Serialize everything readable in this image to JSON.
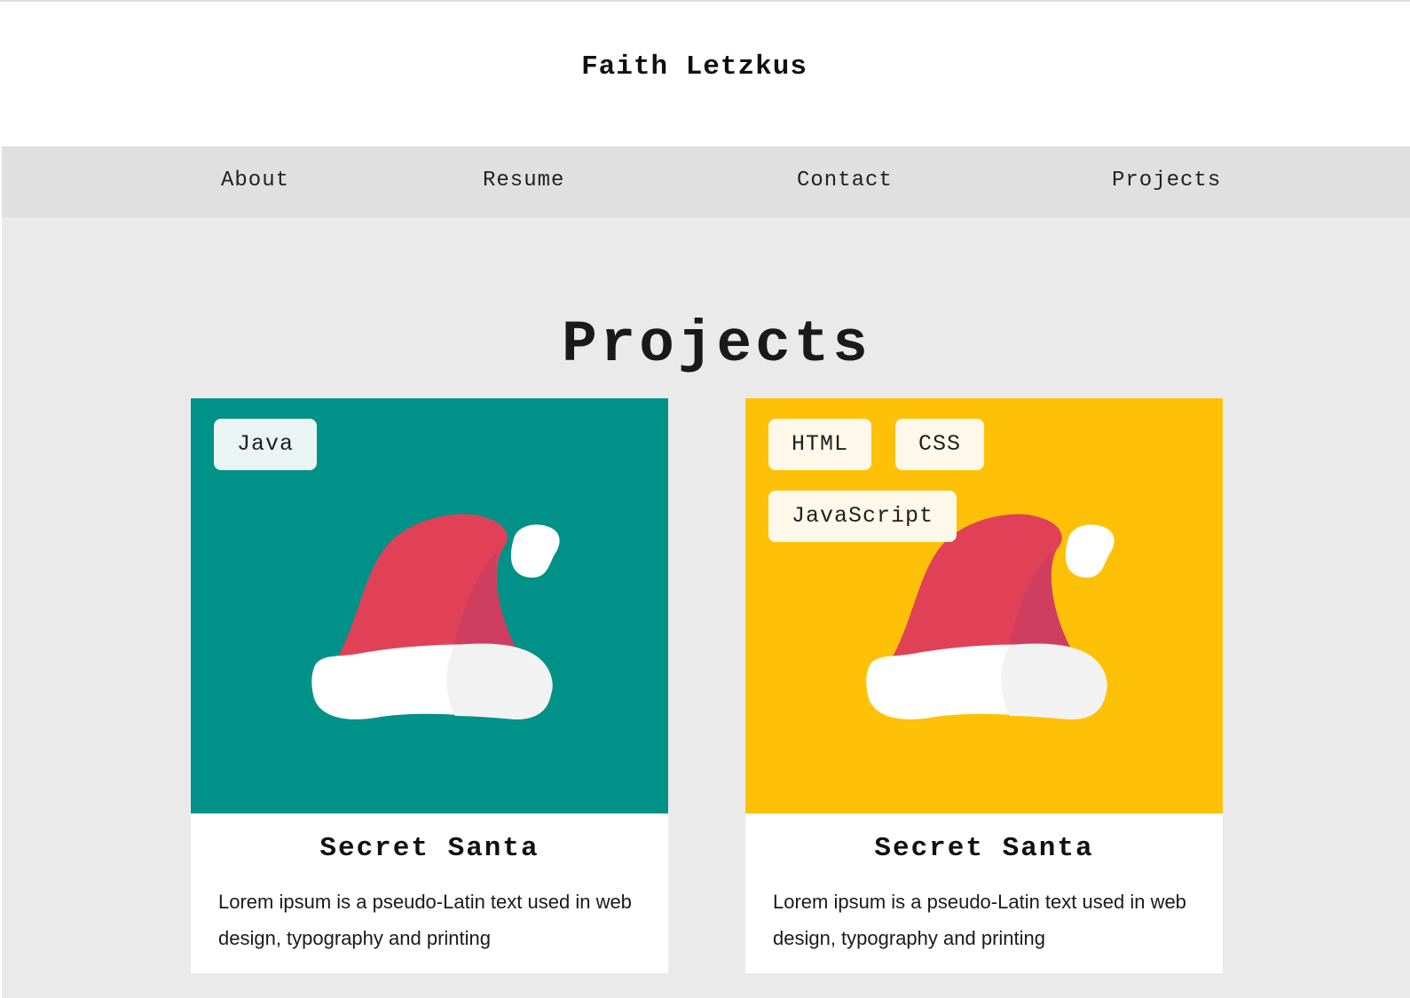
{
  "site": {
    "title": "Faith Letzkus"
  },
  "nav": {
    "items": [
      {
        "label": "About"
      },
      {
        "label": "Resume"
      },
      {
        "label": "Contact"
      },
      {
        "label": "Projects"
      }
    ]
  },
  "main": {
    "heading": "Projects",
    "projects": [
      {
        "title": "Secret Santa",
        "description": "Lorem ipsum is a pseudo-Latin text used in web design, typography and printing",
        "tags": [
          "Java"
        ],
        "image": "santa-hat-icon",
        "background_color": "#009188",
        "tag_color": "#eaf4f2"
      },
      {
        "title": "Secret Santa",
        "description": "Lorem ipsum is a pseudo-Latin text used in web design, typography and printing",
        "tags": [
          "HTML",
          "CSS",
          "JavaScript"
        ],
        "image": "santa-hat-icon",
        "background_color": "#ffc107",
        "tag_color": "#fdf8ea"
      }
    ]
  },
  "colors": {
    "header_bg": "#ffffff",
    "nav_bg": "#e0e0e0",
    "main_bg": "#eaeaea",
    "hat_red": "#e14156",
    "hat_shadow": "#cf3d5f",
    "hat_white": "#ffffff"
  }
}
